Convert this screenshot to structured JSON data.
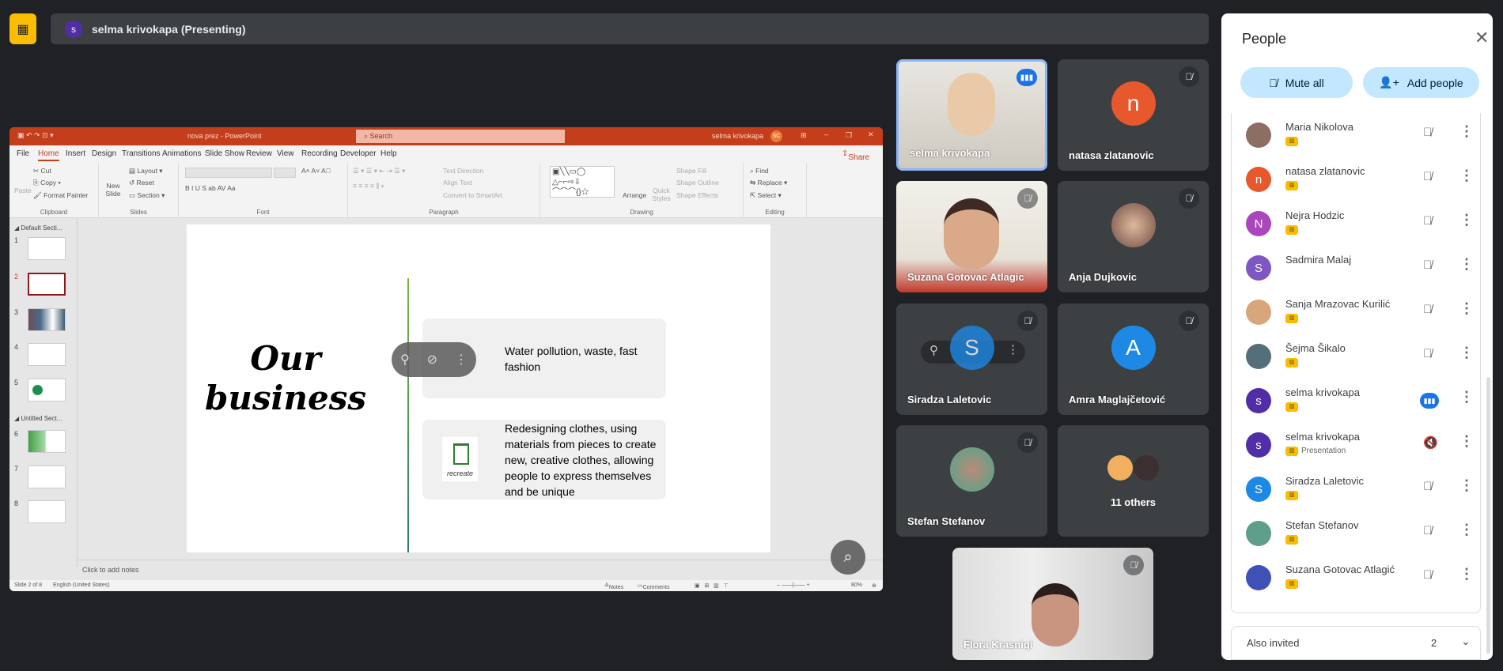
{
  "topbar": {
    "app_icon": "no-video-icon",
    "presenter_initial": "s",
    "title": "selma krivokapa (Presenting)"
  },
  "ppt": {
    "window_title": "nova prez  -  PowerPoint",
    "search_placeholder": "Search",
    "user": "selma krivokapa",
    "user_initials": "SC",
    "tabs": [
      "File",
      "Home",
      "Insert",
      "Design",
      "Transitions",
      "Animations",
      "Slide Show",
      "Review",
      "View",
      "Recording",
      "Developer",
      "Help"
    ],
    "share": "Share",
    "ribbon": {
      "clipboard": {
        "label": "Clipboard",
        "paste": "Paste",
        "cut": "Cut",
        "copy": "Copy",
        "format_painter": "Format Painter"
      },
      "slides": {
        "label": "Slides",
        "new_slide": "New Slide",
        "layout": "Layout",
        "reset": "Reset",
        "section": "Section"
      },
      "font": {
        "label": "Font",
        "format_buttons": "B  I  U  S  ab  AV  Aa"
      },
      "paragraph": {
        "label": "Paragraph",
        "text_direction": "Text Direction",
        "align_text": "Align Text",
        "smartart": "Convert to SmartArt"
      },
      "drawing": {
        "label": "Drawing",
        "arrange": "Arrange",
        "quick_styles": "Quick Styles",
        "shape_fill": "Shape Fill",
        "shape_outline": "Shape Outline",
        "shape_effects": "Shape Effects"
      },
      "editing": {
        "label": "Editing",
        "find": "Find",
        "replace": "Replace",
        "select": "Select"
      }
    },
    "sections": [
      "Default Secti...",
      "Untitled Sect..."
    ],
    "slide_numbers": [
      "1",
      "2",
      "3",
      "4",
      "5",
      "6",
      "7",
      "8"
    ],
    "current_slide": 2,
    "slide": {
      "title": "Our business",
      "card1": "Water pollution, waste, fast fashion",
      "card2": "Redesigning clothes, using materials from pieces to create new, creative clothes, allowing people to express themselves and be unique",
      "logo_text": "recreate"
    },
    "notes_placeholder": "Click to add notes",
    "status": {
      "slide": "Slide 2 of 8",
      "language": "English (United States)",
      "notes": "Notes",
      "comments": "Comments",
      "zoom": "80%"
    }
  },
  "tiles": [
    {
      "name": "selma krivokapa",
      "type": "video",
      "speaking": true
    },
    {
      "name": "natasa zlatanovic",
      "initial": "n",
      "color": "#e8582d"
    },
    {
      "name": "Suzana Gotovac Atlagic",
      "type": "video"
    },
    {
      "name": "Anja Dujkovic",
      "type": "photo"
    },
    {
      "name": "Siradza Laletovic",
      "initial": "S",
      "color": "#1e88e5"
    },
    {
      "name": "Amra Maglajčetović",
      "initial": "A",
      "color": "#1e88e5"
    },
    {
      "name": "Stefan Stefanov",
      "type": "photo"
    },
    {
      "name": "11 others"
    },
    {
      "name": "Flora Krasniqi",
      "type": "video"
    }
  ],
  "people": {
    "title": "People",
    "mute_all": "Mute all",
    "add_people": "Add people",
    "list": [
      {
        "name": "Maria Nikolova",
        "initial": "",
        "color": "#8d6e63",
        "mic": "muted"
      },
      {
        "name": "natasa zlatanovic",
        "initial": "n",
        "color": "#e8582d",
        "mic": "muted"
      },
      {
        "name": "Nejra Hodzic",
        "initial": "N",
        "color": "#ab47bc",
        "mic": "muted"
      },
      {
        "name": "Sadmira Malaj",
        "initial": "S",
        "color": "#7e57c2",
        "mic": "muted"
      },
      {
        "name": "Sanja Mrazovac Kurilić",
        "initial": "",
        "color": "#d7a77b",
        "mic": "muted"
      },
      {
        "name": "Šejma Šikalo",
        "initial": "",
        "color": "#546e7a",
        "mic": "muted"
      },
      {
        "name": "selma krivokapa",
        "initial": "s",
        "color": "#512da8",
        "mic": "speaking"
      },
      {
        "name": "selma krivokapa",
        "initial": "s",
        "color": "#512da8",
        "mic": "presentation-audio-off",
        "sub": "Presentation"
      },
      {
        "name": "Siradza Laletovic",
        "initial": "S",
        "color": "#1e88e5",
        "mic": "muted"
      },
      {
        "name": "Stefan Stefanov",
        "initial": "",
        "color": "#5f9e8a",
        "mic": "muted"
      },
      {
        "name": "Suzana Gotovac Atlagić",
        "initial": "",
        "color": "#3f51b5",
        "mic": "muted"
      }
    ],
    "also_invited": "Also invited",
    "also_invited_count": "2"
  }
}
